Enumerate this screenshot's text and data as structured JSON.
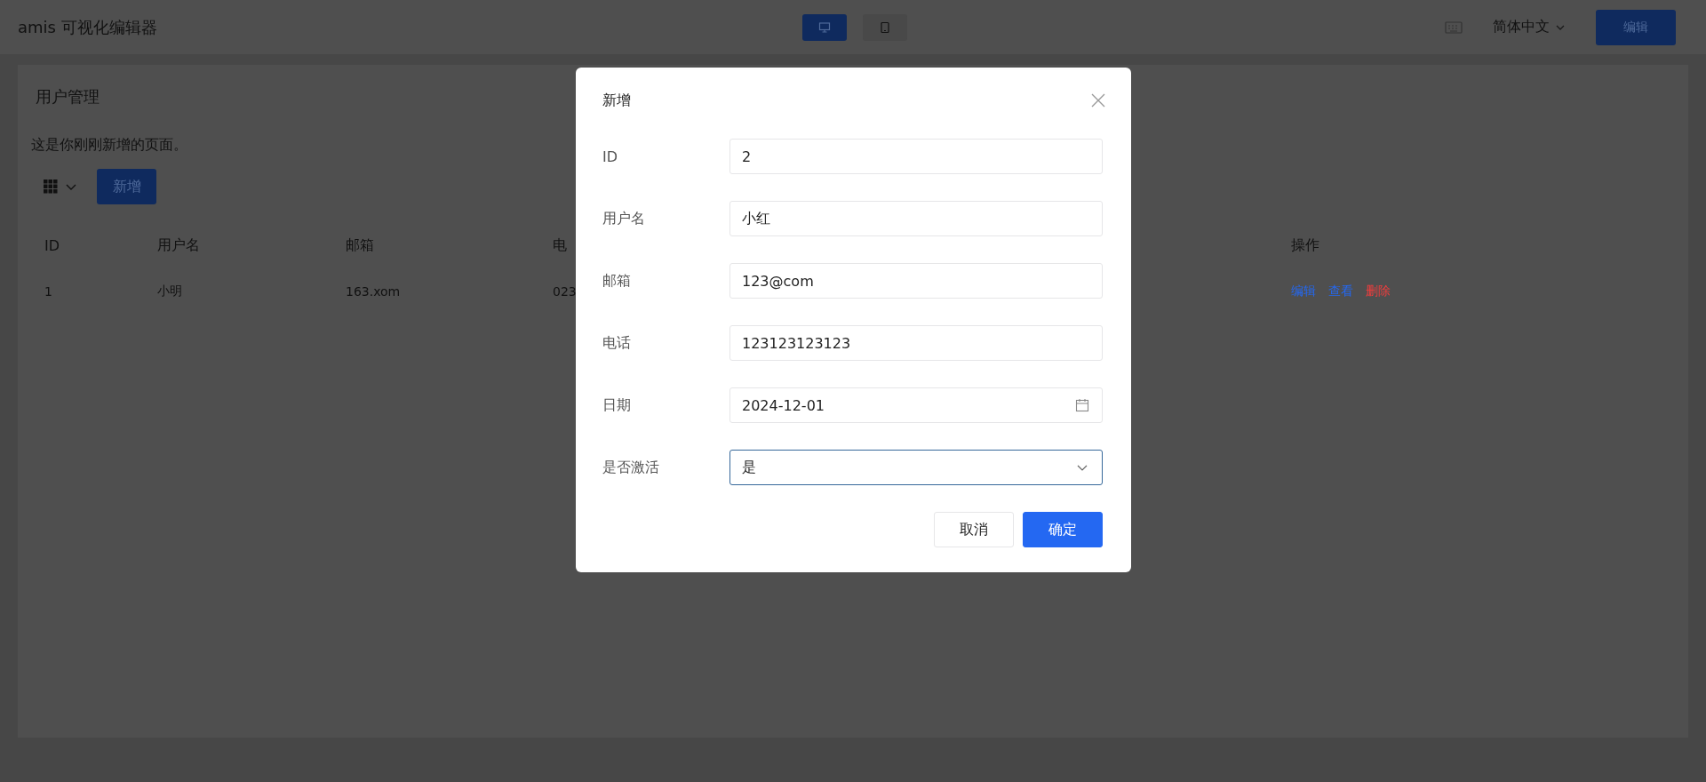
{
  "topbar": {
    "title": "amis 可视化编辑器",
    "devices": [
      {
        "kind": "desktop",
        "selected": true
      },
      {
        "kind": "tablet",
        "selected": false
      }
    ],
    "language": "简体中文",
    "edit_button": "编辑"
  },
  "page": {
    "title": "用户管理",
    "description": "这是你刚刚新增的页面。",
    "add_button": "新增",
    "table": {
      "columns": [
        "ID",
        "用户名",
        "邮箱",
        "电",
        "操作"
      ],
      "rows": [
        {
          "cells": [
            "1",
            "小明",
            "163.xom",
            "023"
          ],
          "actions": [
            {
              "label": "编辑",
              "color": "#2468f2"
            },
            {
              "label": "查看",
              "color": "#2468f2"
            },
            {
              "label": "删除",
              "color": "#f23d3d"
            }
          ]
        }
      ]
    }
  },
  "modal": {
    "title": "新增",
    "fields": [
      {
        "label": "ID",
        "kind": "text",
        "value": "2",
        "focused": false
      },
      {
        "label": "用户名",
        "kind": "text",
        "value": "小红",
        "focused": false
      },
      {
        "label": "邮箱",
        "kind": "text",
        "value": "123@com",
        "focused": false
      },
      {
        "label": "电话",
        "kind": "text",
        "value": "123123123123",
        "focused": false
      },
      {
        "label": "日期",
        "kind": "date",
        "value": "2024-12-01",
        "focused": false
      },
      {
        "label": "是否激活",
        "kind": "select",
        "value": "是",
        "focused": true
      }
    ],
    "buttons": [
      {
        "label": "取消",
        "kind": "default"
      },
      {
        "label": "确定",
        "kind": "primary"
      }
    ]
  }
}
